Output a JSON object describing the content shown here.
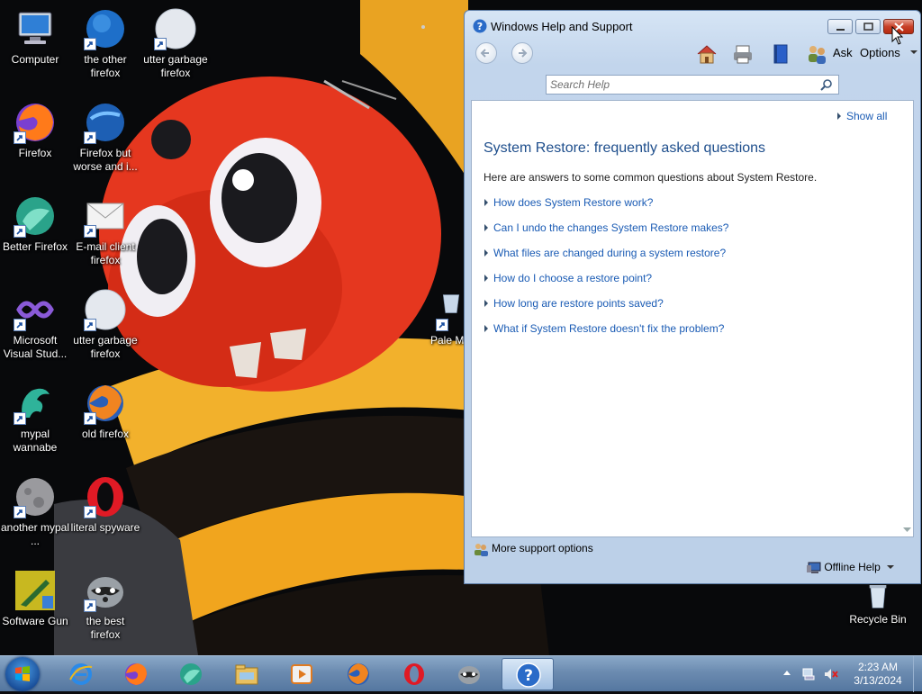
{
  "desktop": {
    "icons": [
      {
        "label": "Computer",
        "icon": "computer-icon"
      },
      {
        "label": "the other firefox",
        "icon": "browser-globe-icon"
      },
      {
        "label": "utter garbage firefox",
        "icon": "white-globe-icon"
      },
      {
        "label": "Firefox",
        "icon": "firefox-icon"
      },
      {
        "label": "Firefox but worse and i...",
        "icon": "browser-globe-icon"
      },
      {
        "label": "Better Firefox",
        "icon": "teal-globe-icon"
      },
      {
        "label": "E-mail client firefox",
        "icon": "envelope-icon"
      },
      {
        "label": "Microsoft Visual Stud...",
        "icon": "visual-studio-icon"
      },
      {
        "label": "utter garbage firefox",
        "icon": "white-globe-icon"
      },
      {
        "label": "mypal wannabe",
        "icon": "dragon-icon"
      },
      {
        "label": "old firefox",
        "icon": "firefox-icon"
      },
      {
        "label": "another mypal ...",
        "icon": "moon-icon"
      },
      {
        "label": "literal spyware",
        "icon": "opera-icon"
      },
      {
        "label": "Software Gun",
        "icon": "software-gun-icon"
      },
      {
        "label": "the best firefox",
        "icon": "raccoon-icon"
      },
      {
        "label": "Pale Moon-...",
        "icon": "recycle-bin-icon"
      },
      {
        "label": "Recycle Bin",
        "icon": "recycle-bin-icon"
      }
    ]
  },
  "window": {
    "title": "Windows Help and Support",
    "toolbar": {
      "ask": "Ask",
      "options": "Options"
    },
    "search": {
      "placeholder": "Search Help"
    },
    "content": {
      "show_all": "Show all",
      "title": "System Restore: frequently asked questions",
      "intro": "Here are answers to some common questions about System Restore.",
      "questions": [
        "How does System Restore work?",
        "Can I undo the changes System Restore makes?",
        "What files are changed during a system restore?",
        "How do I choose a restore point?",
        "How long are restore points saved?",
        "What if System Restore doesn't fix the problem?"
      ]
    },
    "footer": {
      "more_support": "More support options",
      "offline_help": "Offline Help"
    }
  },
  "taskbar": {
    "apps": [
      "internet-explorer-icon",
      "firefox-icon",
      "teal-globe-icon",
      "file-explorer-icon",
      "media-player-icon",
      "firefox-icon",
      "opera-icon",
      "raccoon-icon",
      "help-icon"
    ],
    "clock": {
      "time": "2:23 AM",
      "date": "3/13/2024"
    }
  },
  "colors": {
    "link": "#1a5bb4",
    "title": "#1e4e8c",
    "close_button": "#c84028"
  }
}
